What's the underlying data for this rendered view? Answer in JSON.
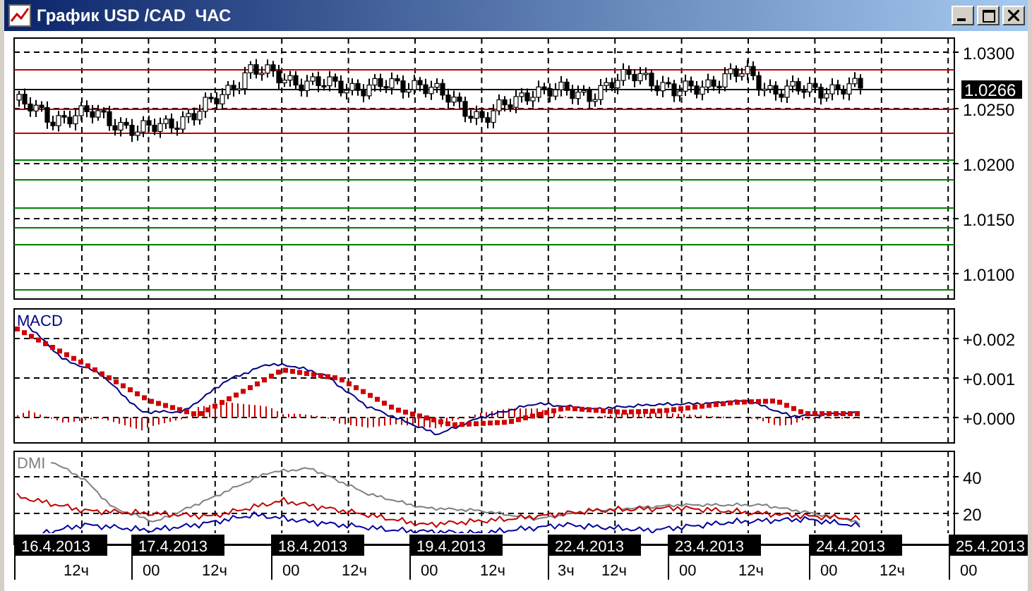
{
  "window": {
    "title": "График USD /CAD  ЧАС"
  },
  "price_panel": {
    "axis_labels": [
      "1.0300",
      "1.0250",
      "1.0200",
      "1.0150",
      "1.0100"
    ],
    "current_price": "1.0266"
  },
  "macd_panel": {
    "label": "MACD",
    "axis_labels": [
      "+0.002",
      "+0.001",
      "+0.000"
    ]
  },
  "dmi_panel": {
    "label": "DMI",
    "axis_labels": [
      "40",
      "20"
    ]
  },
  "time_axis": [
    {
      "date": "16.4.2013",
      "times": [
        "12ч"
      ]
    },
    {
      "date": "17.4.2013",
      "times": [
        "00",
        "12ч"
      ]
    },
    {
      "date": "18.4.2013",
      "times": [
        "00",
        "12ч"
      ]
    },
    {
      "date": "19.4.2013",
      "times": [
        "00",
        "12ч"
      ]
    },
    {
      "date": "22.4.2013",
      "times": [
        "3ч",
        "12ч"
      ]
    },
    {
      "date": "23.4.2013",
      "times": [
        "00",
        "12ч"
      ]
    },
    {
      "date": "24.4.2013",
      "times": [
        "00",
        "12ч"
      ]
    },
    {
      "date": "25.4.2013",
      "times": [
        "00"
      ]
    }
  ]
}
